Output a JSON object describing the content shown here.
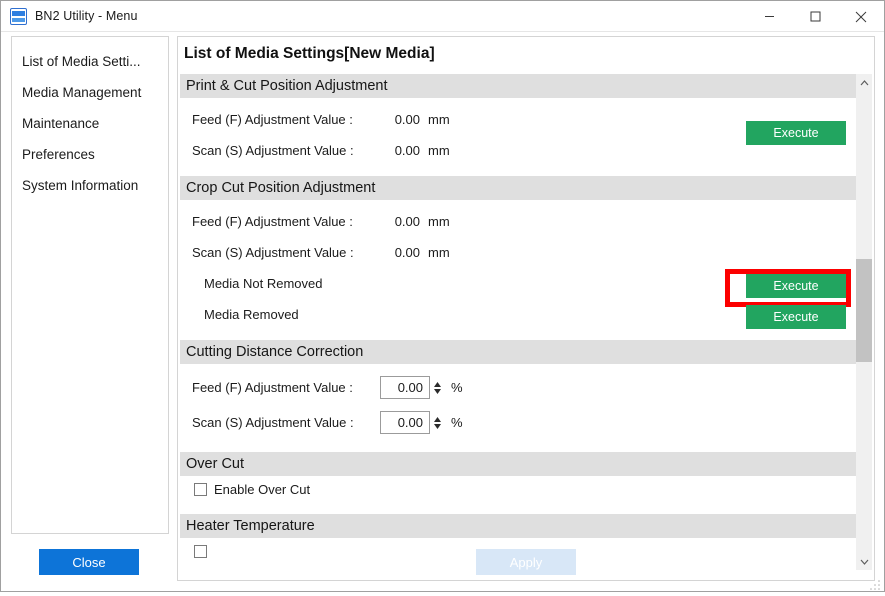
{
  "window": {
    "title": "BN2 Utility - Menu",
    "icon": "bn2-app-icon",
    "controls": {
      "minimize": "minimize-icon",
      "maximize": "maximize-icon",
      "close": "close-icon"
    }
  },
  "sidebar": {
    "items": [
      {
        "label": "List of Media Setti..."
      },
      {
        "label": "Media Management"
      },
      {
        "label": "Maintenance"
      },
      {
        "label": "Preferences"
      },
      {
        "label": "System Information"
      }
    ]
  },
  "main": {
    "title": "List of Media Settings[New Media]",
    "sections": [
      {
        "header": "Print & Cut Position Adjustment",
        "rows": [
          {
            "label": "Feed (F) Adjustment Value :",
            "value": "0.00",
            "unit": "mm"
          },
          {
            "label": "Scan (S) Adjustment Value :",
            "value": "0.00",
            "unit": "mm"
          }
        ],
        "execute_label": "Execute"
      },
      {
        "header": "Crop Cut Position Adjustment",
        "rows": [
          {
            "label": "Feed (F) Adjustment Value :",
            "value": "0.00",
            "unit": "mm"
          },
          {
            "label": "Scan (S) Adjustment Value :",
            "value": "0.00",
            "unit": "mm"
          },
          {
            "label": "Media Not Removed"
          },
          {
            "label": "Media Removed"
          }
        ],
        "execute_label_1": "Execute",
        "execute_label_2": "Execute"
      },
      {
        "header": "Cutting Distance Correction",
        "rows": [
          {
            "label": "Feed (F) Adjustment Value :",
            "value": "0.00",
            "unit": "%"
          },
          {
            "label": "Scan (S) Adjustment Value :",
            "value": "0.00",
            "unit": "%"
          }
        ]
      },
      {
        "header": "Over Cut",
        "checkbox_label": "Enable Over Cut",
        "checked": false
      },
      {
        "header": "Heater Temperature"
      }
    ]
  },
  "highlight": {
    "color": "#fc0000",
    "target": "crop-cut-media-not-removed-execute"
  },
  "footer": {
    "close_label": "Close",
    "apply_label": "Apply",
    "apply_disabled": true
  },
  "colors": {
    "execute_green": "#22a560",
    "close_blue": "#0d74d8",
    "apply_disabled": "#d8e7f7",
    "section_header_bg": "#dfdfdf",
    "highlight_red": "#fc0000"
  }
}
